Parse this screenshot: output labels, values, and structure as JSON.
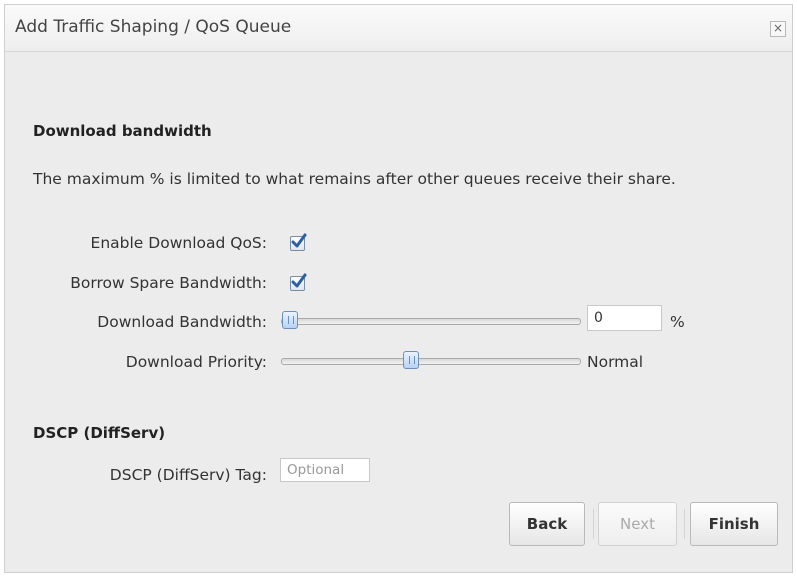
{
  "dialog": {
    "title": "Add Traffic Shaping / QoS Queue",
    "close_label": "×"
  },
  "download_section": {
    "heading": "Download bandwidth",
    "description": "The maximum % is limited to what remains after other queues receive their share.",
    "enable_qos": {
      "label": "Enable Download QoS:",
      "checked": true
    },
    "borrow_spare": {
      "label": "Borrow Spare Bandwidth:",
      "checked": true
    },
    "bandwidth": {
      "label": "Download Bandwidth:",
      "value": "0",
      "unit": "%",
      "slider_fraction": 0.0
    },
    "priority": {
      "label": "Download Priority:",
      "value_text": "Normal",
      "slider_fraction": 0.43
    }
  },
  "dscp_section": {
    "heading": "DSCP (DiffServ)",
    "tag": {
      "label": "DSCP (DiffServ) Tag:",
      "placeholder": "Optional",
      "value": ""
    }
  },
  "buttons": {
    "back": "Back",
    "next": "Next",
    "finish": "Finish"
  },
  "colors": {
    "dialog_bg": "#ececec",
    "checkbox_check": "#2d5fa8",
    "slider_handle": "#b8d2f2"
  }
}
